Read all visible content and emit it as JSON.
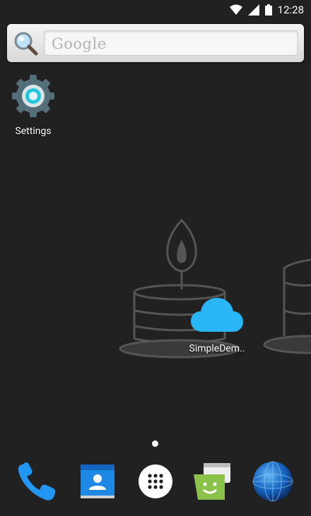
{
  "status_bar": {
    "time": "12:28"
  },
  "search_widget": {
    "placeholder": "Google"
  },
  "desktop": {
    "apps": [
      {
        "label": "Settings"
      },
      {
        "label": "SimpleDem.."
      }
    ]
  },
  "dock": [
    {
      "icon": "phone-icon"
    },
    {
      "icon": "contacts-icon"
    },
    {
      "icon": "all-apps-icon"
    },
    {
      "icon": "messaging-icon"
    },
    {
      "icon": "browser-icon"
    }
  ]
}
